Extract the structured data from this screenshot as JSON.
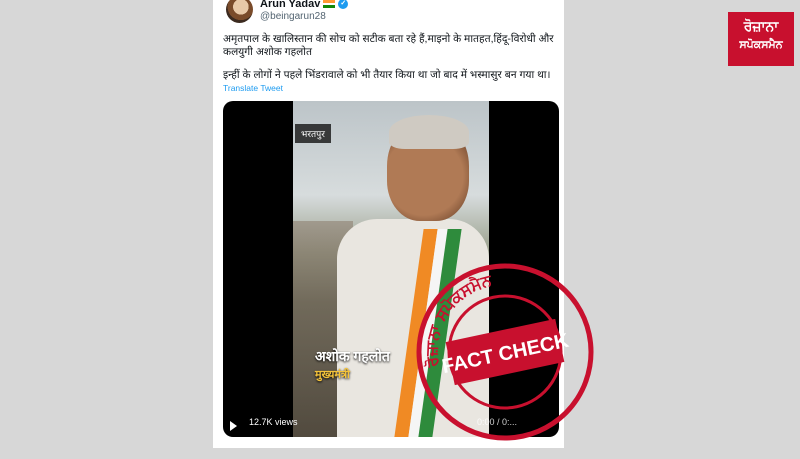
{
  "tweet": {
    "author_name": "Arun Yadav",
    "handle": "@beingarun28",
    "paragraph_1": "अमृतपाल के खालिस्तान की सोच को सटीक बता रहे हैं,माइनो के मातहत,हिंदू-विरोधी और कलयुगी अशोक गहलोत",
    "paragraph_2": "इन्हीं के लोगों ने पहले भिंडरावाले को भी तैयार किया था जो बाद में भस्मासुर बन गया था।",
    "translate_label": "Translate Tweet"
  },
  "video": {
    "location_tag": "भरतपुर",
    "caption_name": "अशोक गहलोत",
    "caption_title": "मुख्यमंत्री",
    "views": "12.7K views",
    "timecode": "0:00 / 0:..."
  },
  "branding": {
    "logo_line_1": "ਰੋਜ਼ਾਨਾ",
    "logo_line_2": "ਸਪੋਕਸਮੈਨ",
    "stamp_text": "FACT CHECK",
    "stamp_ring_text": "ਰੋਜ਼ਾਨਾ ਸਪੋਕਸਮੈਨ",
    "accent_red": "#c8102e"
  },
  "icons": {
    "verified": "verified-badge-icon",
    "flag": "india-flag-icon",
    "play": "play-icon"
  }
}
